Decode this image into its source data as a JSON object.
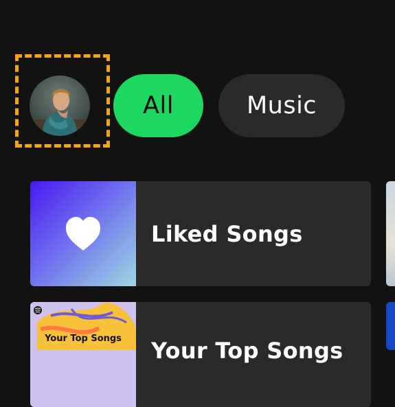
{
  "filters": [
    {
      "label": "All",
      "active": true
    },
    {
      "label": "Music",
      "active": false
    }
  ],
  "shortcuts": [
    {
      "title": "Liked Songs",
      "cover_icon": "heart-icon"
    },
    {
      "title": "Your Top Songs",
      "cover_label": "Your Top Songs",
      "cover_icon": "spotify-logo-icon"
    }
  ],
  "colors": {
    "background": "#121212",
    "accent": "#1ed760",
    "chip_inactive": "#2a2a2a",
    "highlight_dashed": "#f5a513"
  }
}
